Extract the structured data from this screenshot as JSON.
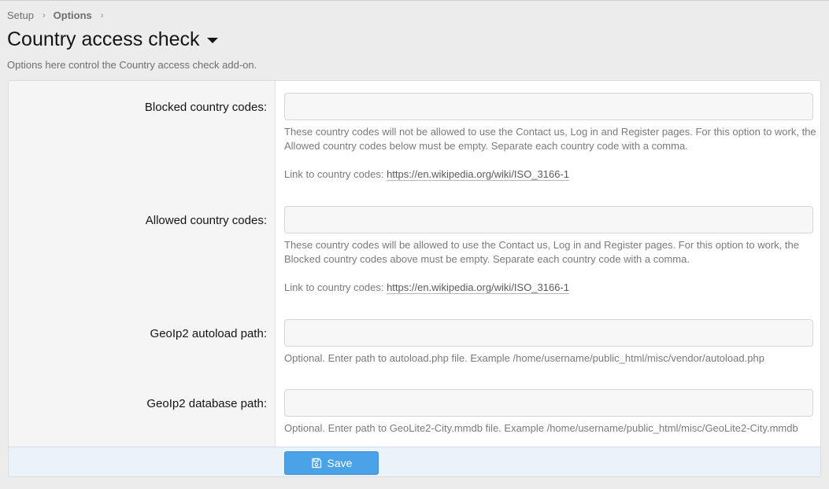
{
  "breadcrumb": {
    "items": [
      "Setup",
      "Options"
    ]
  },
  "header": {
    "title": "Country access check",
    "description": "Options here control the Country access check add-on."
  },
  "form": {
    "blocked": {
      "label": "Blocked country codes:",
      "value": "",
      "hint": "These country codes will not be allowed to use the Contact us, Log in and Register pages. For this option to work, the Allowed country codes below must be empty. Separate each country code with a comma.",
      "link_prefix": "Link to country codes: ",
      "link": "https://en.wikipedia.org/wiki/ISO_3166-1"
    },
    "allowed": {
      "label": "Allowed country codes:",
      "value": "",
      "hint": "These country codes will be allowed to use the Contact us, Log in and Register pages. For this option to work, the Blocked country codes above must be empty. Separate each country code with a comma.",
      "link_prefix": "Link to country codes: ",
      "link": "https://en.wikipedia.org/wiki/ISO_3166-1"
    },
    "autoload": {
      "label": "GeoIp2 autoload path:",
      "value": "",
      "hint": "Optional. Enter path to autoload.php file. Example /home/username/public_html/misc/vendor/autoload.php"
    },
    "database": {
      "label": "GeoIp2 database path:",
      "value": "",
      "hint": "Optional. Enter path to GeoLite2-City.mmdb file. Example /home/username/public_html/misc/GeoLite2-City.mmdb"
    }
  },
  "footer": {
    "save_label": "Save",
    "save_icon": "save-icon"
  },
  "colors": {
    "accent": "#4aa3e6",
    "footer_bg": "#eaf2fa"
  }
}
